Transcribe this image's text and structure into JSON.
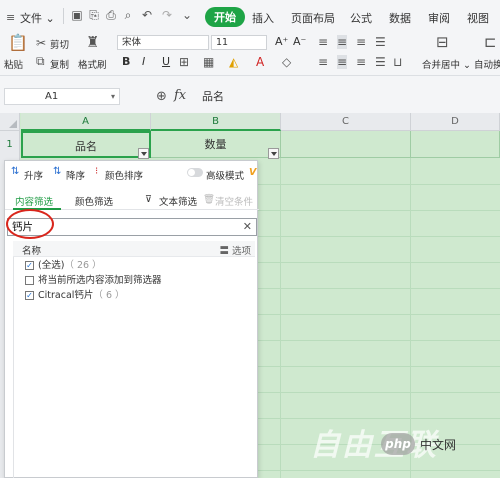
{
  "menubar": {
    "file_label": "文件",
    "file_arrow": "⌄",
    "tabs": [
      "开始",
      "插入",
      "页面布局",
      "公式",
      "数据",
      "审阅",
      "视图"
    ],
    "active_tab": "开始"
  },
  "ribbon": {
    "paste": "粘贴",
    "cut": "剪切",
    "copy": "复制",
    "format_painter": "格式刷",
    "font_name": "宋体",
    "font_size": "11",
    "bold": "B",
    "italic": "I",
    "underline": "U",
    "grow_font": "A⁺",
    "shrink_font": "A⁻",
    "merge_center": "合并居中",
    "auto_wrap": "自动换"
  },
  "formula_bar": {
    "cell_ref": "A1",
    "fx": "fx",
    "value": "品名"
  },
  "sheet": {
    "columns": [
      "A",
      "B",
      "C",
      "D"
    ],
    "row_numbers": [
      "1"
    ],
    "header_cells": [
      "品名",
      "数量"
    ]
  },
  "filter_popup": {
    "sort_asc": "升序",
    "sort_desc": "降序",
    "sort_color": "颜色排序",
    "advanced_mode": "高级模式",
    "vip_badge": "V",
    "tab_content": "内容筛选",
    "tab_color": "颜色筛选",
    "tab_text": "文本筛选",
    "clear_condition": "清空条件",
    "search_value": "钙片",
    "list_header_name": "名称",
    "list_header_options": "选项",
    "items": [
      {
        "label": "(全选)",
        "count": "（ 26 ）",
        "checked": true
      },
      {
        "label": "将当前所选内容添加到筛选器",
        "count": "",
        "checked": false
      },
      {
        "label": "Citracal钙片",
        "count": "（ 6 ）",
        "checked": true
      }
    ]
  },
  "watermark": {
    "brand_text": "自由互联",
    "badge": "php",
    "site": "中文网"
  }
}
